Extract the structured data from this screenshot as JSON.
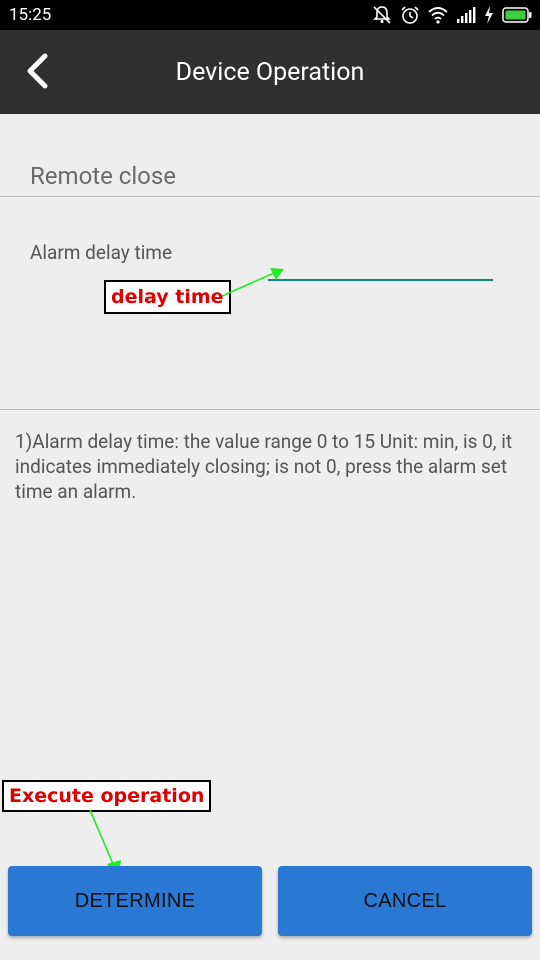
{
  "status_bar": {
    "time": "15:25",
    "icons": [
      "mute-icon",
      "alarm-clock-icon",
      "wifi-icon",
      "signal-icon",
      "charging-icon",
      "battery-icon"
    ]
  },
  "app_bar": {
    "title": "Device Operation",
    "back_icon": "chevron-left-icon"
  },
  "section": {
    "title": "Remote close"
  },
  "form": {
    "alarm_delay_label": "Alarm delay time",
    "alarm_delay_value": "",
    "input_underline_color": "#0f8a7d"
  },
  "description": "1)Alarm delay time: the value range 0 to 15 Unit: min, is 0, it indicates immediately closing; is not 0, press the alarm set time an alarm.",
  "annotations": {
    "delay_time": "delay time",
    "execute_operation": "Execute operation",
    "text_color": "#e00000",
    "arrow_color": "#22ee22"
  },
  "buttons": {
    "determine": "DETERMINE",
    "cancel": "CANCEL",
    "color": "#2a78d4"
  }
}
